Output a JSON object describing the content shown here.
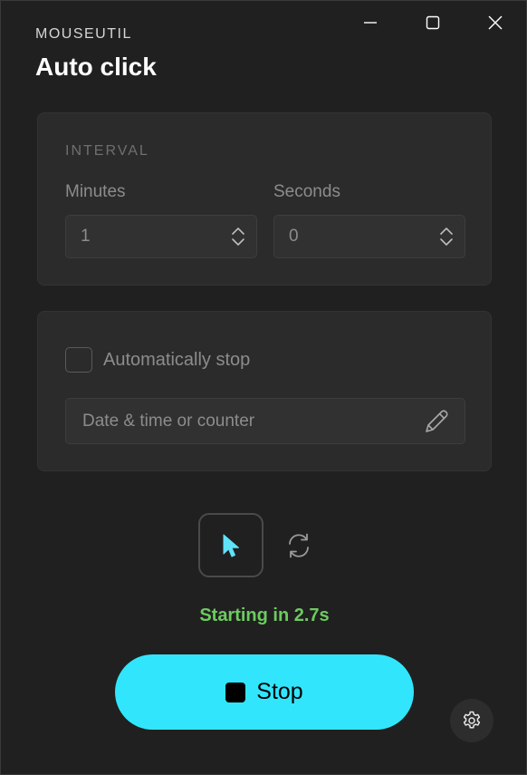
{
  "window": {
    "controls": [
      "minimize-icon",
      "maximize-icon",
      "close-icon"
    ]
  },
  "header": {
    "app_name": "MOUSEUTIL",
    "title": "Auto click"
  },
  "interval": {
    "section_label": "INTERVAL",
    "minutes_label": "Minutes",
    "minutes_value": "1",
    "seconds_label": "Seconds",
    "seconds_value": "0"
  },
  "auto_stop": {
    "checkbox_label": "Automatically stop",
    "checked": false,
    "field_placeholder": "Date & time or counter",
    "field_icon": "pencil-icon"
  },
  "modes": {
    "click_icon": "cursor-icon",
    "repeat_icon": "repeat-icon"
  },
  "status": {
    "text": "Starting in 2.7s",
    "color": "#6ccb5f"
  },
  "actions": {
    "stop_label": "Stop",
    "stop_color": "#31e6fc",
    "settings_icon": "gear-icon"
  }
}
